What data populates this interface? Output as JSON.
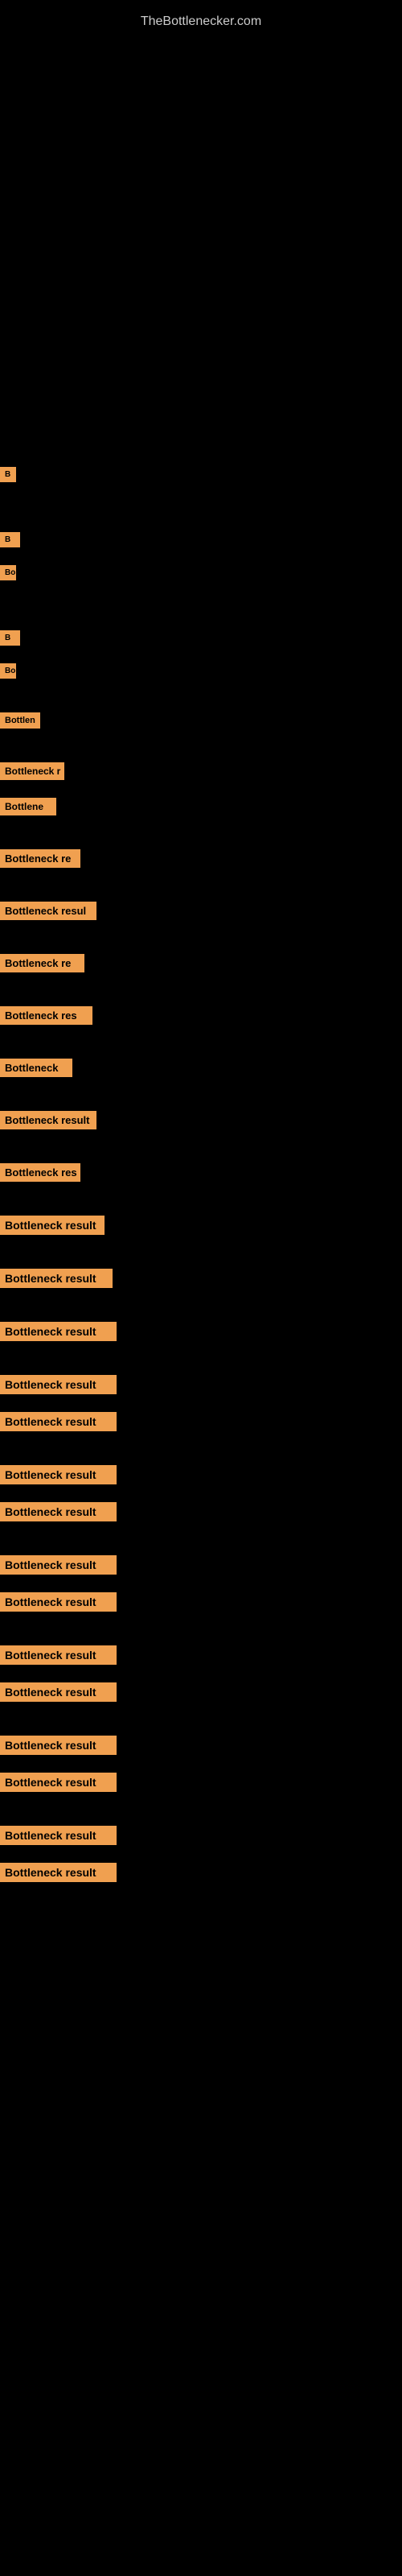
{
  "site": {
    "title": "TheBottlenecker.com"
  },
  "items": [
    {
      "id": 1,
      "label": "B"
    },
    {
      "id": 2,
      "label": "B"
    },
    {
      "id": 3,
      "label": "Bo"
    },
    {
      "id": 4,
      "label": "B"
    },
    {
      "id": 5,
      "label": "Bo"
    },
    {
      "id": 6,
      "label": "Bottlen"
    },
    {
      "id": 7,
      "label": "Bottleneck r"
    },
    {
      "id": 8,
      "label": "Bottlene"
    },
    {
      "id": 9,
      "label": "Bottleneck re"
    },
    {
      "id": 10,
      "label": "Bottleneck resul"
    },
    {
      "id": 11,
      "label": "Bottleneck re"
    },
    {
      "id": 12,
      "label": "Bottleneck res"
    },
    {
      "id": 13,
      "label": "Bottleneck"
    },
    {
      "id": 14,
      "label": "Bottleneck result"
    },
    {
      "id": 15,
      "label": "Bottleneck res"
    },
    {
      "id": 16,
      "label": "Bottleneck result"
    },
    {
      "id": 17,
      "label": "Bottleneck result"
    },
    {
      "id": 18,
      "label": "Bottleneck result"
    },
    {
      "id": 19,
      "label": "Bottleneck result"
    },
    {
      "id": 20,
      "label": "Bottleneck result"
    },
    {
      "id": 21,
      "label": "Bottleneck result"
    },
    {
      "id": 22,
      "label": "Bottleneck result"
    },
    {
      "id": 23,
      "label": "Bottleneck result"
    },
    {
      "id": 24,
      "label": "Bottleneck result"
    },
    {
      "id": 25,
      "label": "Bottleneck result"
    },
    {
      "id": 26,
      "label": "Bottleneck result"
    },
    {
      "id": 27,
      "label": "Bottleneck result"
    },
    {
      "id": 28,
      "label": "Bottleneck result"
    },
    {
      "id": 29,
      "label": "Bottleneck result"
    },
    {
      "id": 30,
      "label": "Bottleneck result"
    }
  ]
}
